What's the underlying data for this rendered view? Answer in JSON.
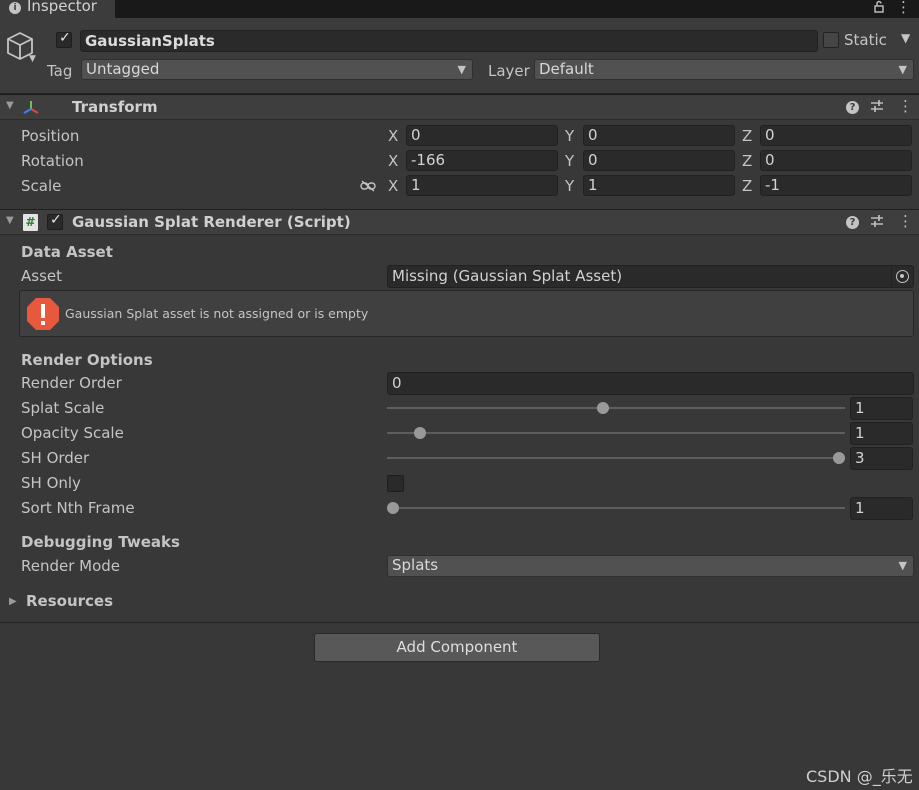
{
  "window": {
    "tab_label": "Inspector",
    "tab_icon": "info-icon",
    "lock_icon": "lock-icon",
    "menu_icon": "kebab-icon"
  },
  "gameobject": {
    "icon": "cube-icon",
    "active": true,
    "name": "GaussianSplats",
    "static_label": "Static",
    "static_checked": false,
    "tag_label": "Tag",
    "tag_value": "Untagged",
    "layer_label": "Layer",
    "layer_value": "Default"
  },
  "transform": {
    "title": "Transform",
    "rows": [
      {
        "label": "Position",
        "x": "0",
        "y": "0",
        "z": "0"
      },
      {
        "label": "Rotation",
        "x": "-166",
        "y": "0",
        "z": "0"
      },
      {
        "label": "Scale",
        "x": "1",
        "y": "1",
        "z": "-1"
      }
    ],
    "axes": {
      "x": "X",
      "y": "Y",
      "z": "Z"
    }
  },
  "renderer": {
    "title": "Gaussian Splat Renderer (Script)",
    "enabled": true,
    "data_asset_section": "Data Asset",
    "asset_label": "Asset",
    "asset_value": "Missing (Gaussian Splat Asset)",
    "warning_text": "Gaussian Splat asset is not assigned or is empty",
    "render_options_section": "Render Options",
    "render_order_label": "Render Order",
    "render_order_value": "0",
    "splat_scale": {
      "label": "Splat Scale",
      "value": "1",
      "fraction": 0.47
    },
    "opacity_scale": {
      "label": "Opacity Scale",
      "value": "1",
      "fraction": 0.06
    },
    "sh_order": {
      "label": "SH Order",
      "value": "3",
      "fraction": 1.0
    },
    "sh_only": {
      "label": "SH Only",
      "checked": false
    },
    "sort_nth_frame": {
      "label": "Sort Nth Frame",
      "value": "1",
      "fraction": 0.0
    },
    "debugging_section": "Debugging Tweaks",
    "render_mode_label": "Render Mode",
    "render_mode_value": "Splats",
    "resources_label": "Resources"
  },
  "add_component_label": "Add Component",
  "watermark": "CSDN @_乐无",
  "colors": {
    "background": "#383838",
    "warning": "#e8583c",
    "field": "#2a2a2a"
  }
}
